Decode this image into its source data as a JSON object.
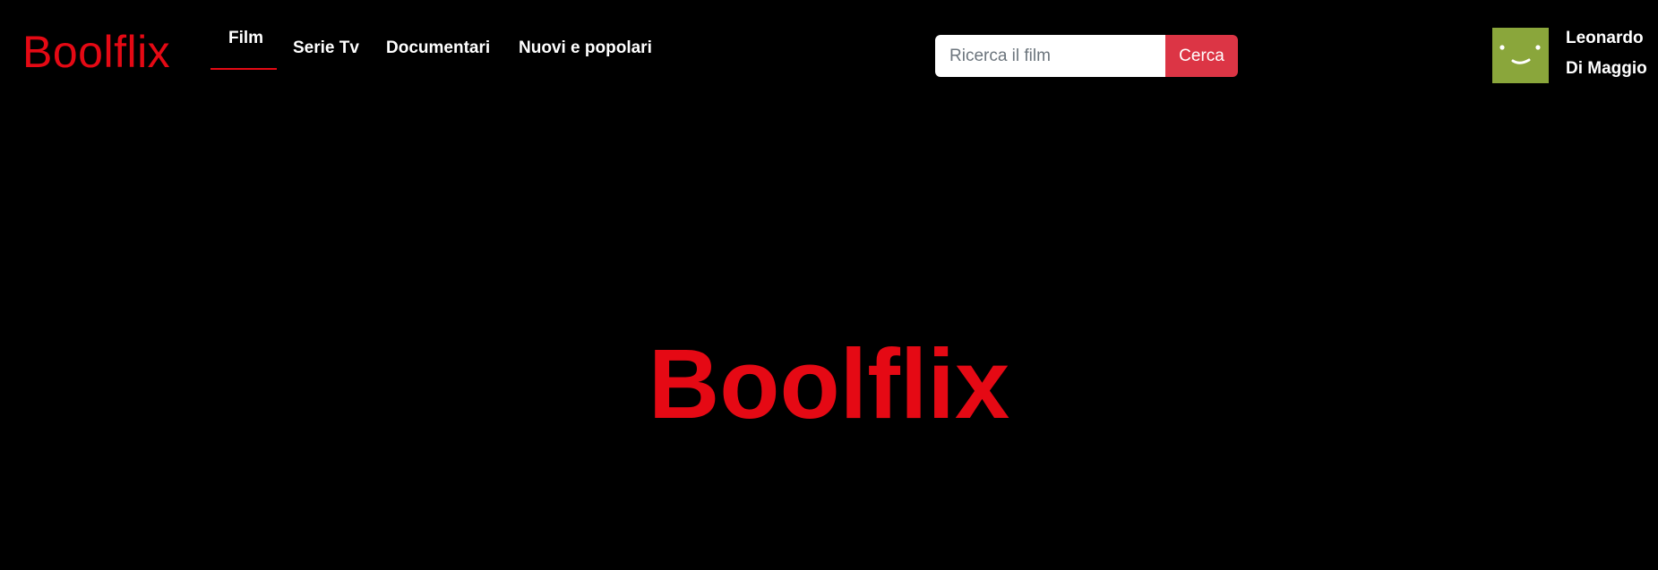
{
  "header": {
    "logo": "Boolflix",
    "nav": [
      {
        "label": "Film",
        "active": true
      },
      {
        "label": "Serie Tv",
        "active": false
      },
      {
        "label": "Documentari",
        "active": false
      },
      {
        "label": "Nuovi e popolari",
        "active": false
      }
    ],
    "search": {
      "placeholder": "Ricerca il film",
      "value": "",
      "button_label": "Cerca"
    },
    "user": {
      "avatar_icon": "smiley-avatar-icon",
      "first_name": "Leonardo",
      "last_name": "Di Maggio"
    }
  },
  "hero": {
    "title": "Boolflix"
  },
  "colors": {
    "brand": "#e50914",
    "background": "#000000",
    "button": "#dc3545",
    "avatar": "#8aa63b"
  }
}
